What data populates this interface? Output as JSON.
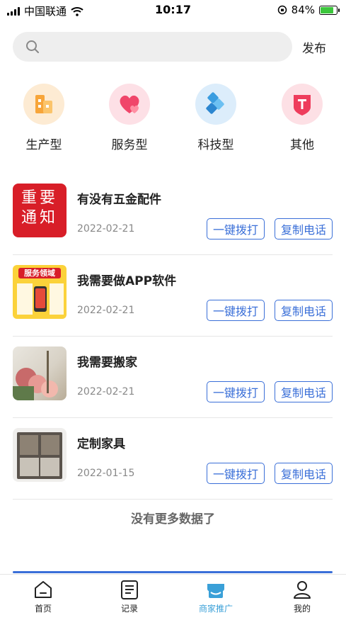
{
  "status_bar": {
    "carrier": "中国联通",
    "time": "10:17",
    "battery": "84%",
    "battery_level": 0.84
  },
  "search": {
    "placeholder": "",
    "publish_label": "发布"
  },
  "categories": [
    {
      "label": "生产型",
      "icon": "building-icon",
      "color": "#f7a53a"
    },
    {
      "label": "服务型",
      "icon": "heart-icon",
      "color": "#f0466a"
    },
    {
      "label": "科技型",
      "icon": "tech-icon",
      "color": "#3a9de0"
    },
    {
      "label": "其他",
      "icon": "t-badge-icon",
      "color": "#ee3d5c"
    }
  ],
  "items": [
    {
      "title": "有没有五金配件",
      "date": "2022-02-21",
      "thumb_text": [
        "重要",
        "通知"
      ]
    },
    {
      "title": "我需要做APP软件",
      "date": "2022-02-21",
      "thumb_text": [
        "服务领域"
      ]
    },
    {
      "title": "我需要搬家",
      "date": "2022-02-21"
    },
    {
      "title": "定制家具",
      "date": "2022-01-15"
    }
  ],
  "item_actions": {
    "call": "一键拨打",
    "copy": "复制电话"
  },
  "no_more": "没有更多数据了",
  "tabs": [
    {
      "label": "首页",
      "icon": "home-icon"
    },
    {
      "label": "记录",
      "icon": "record-icon"
    },
    {
      "label": "商家推广",
      "icon": "shop-icon",
      "active": true
    },
    {
      "label": "我的",
      "icon": "user-icon"
    }
  ],
  "colors": {
    "accent": "#3a6fd8",
    "active_tab": "#3aa0d8"
  }
}
